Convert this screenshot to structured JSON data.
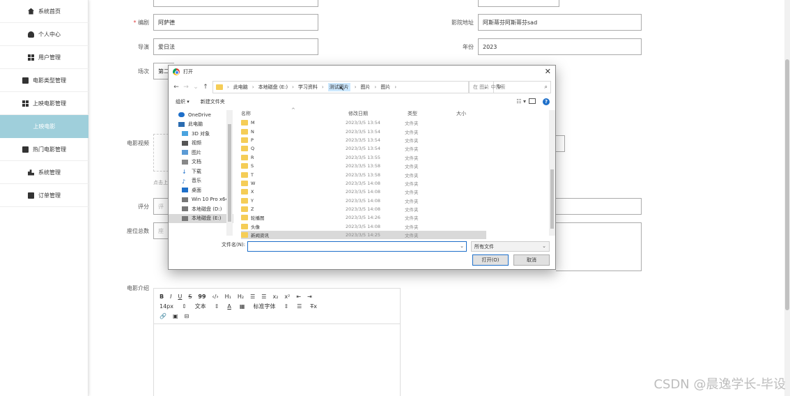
{
  "sidebar": {
    "items": [
      {
        "label": "系统首页",
        "icon": "home-icon"
      },
      {
        "label": "个人中心",
        "icon": "user-icon"
      },
      {
        "label": "用户管理",
        "icon": "grid-icon"
      },
      {
        "label": "电影类型管理",
        "icon": "clipboard-icon"
      },
      {
        "label": "上映电影管理",
        "icon": "grid-icon"
      },
      {
        "label": "上映电影",
        "icon": "none"
      },
      {
        "label": "热门电影管理",
        "icon": "clipboard-icon"
      },
      {
        "label": "系统管理",
        "icon": "chart-icon"
      },
      {
        "label": "订单管理",
        "icon": "clipboard-icon"
      }
    ],
    "active_index": 5
  },
  "form": {
    "bianju_label": "编剧",
    "bianju_required": "*",
    "bianju_value": "阿萨德",
    "daoyan_label": "导演",
    "daoyan_value": "爱日法",
    "changci_label": "场次",
    "changci_value": "第二",
    "video_label": "电影视频",
    "upload_hint": "点击上",
    "pingfen_label": "评分",
    "pingfen_placeholder": "评",
    "seat_label": "座位总数",
    "seat_placeholder": "座",
    "address_label": "影院地址",
    "address_value": "阿斯蒂芬阿斯蒂芬sad",
    "year_label": "年份",
    "year_value": "2023",
    "intro_label": "电影介绍"
  },
  "editor": {
    "row1": [
      "B",
      "I",
      "U",
      "S",
      "99",
      "‹/›",
      "H₁",
      "H₂",
      "☰",
      "☰",
      "x₂",
      "x²",
      "⇤",
      "⇥"
    ],
    "font_size": "14px",
    "text_label": "文本",
    "font_family": "标准字体",
    "clear": "T̶x"
  },
  "dialog": {
    "title": "打开",
    "close": "✕",
    "path": [
      "此电脑",
      "本地磁盘 (E:)",
      "学习资料",
      "测试图片",
      "图片",
      "图片"
    ],
    "search_placeholder": "在 图片 中搜索",
    "organize": "组织 ▾",
    "new_folder": "新建文件夹",
    "columns": {
      "name": "名称",
      "date": "修改日期",
      "type": "类型",
      "size": "大小"
    },
    "nav_items": [
      {
        "label": "OneDrive",
        "icon": "cloud-icon"
      },
      {
        "label": "此电脑",
        "icon": "pc-icon"
      },
      {
        "label": "3D 对象",
        "icon": "cube-icon"
      },
      {
        "label": "视频",
        "icon": "video-icon"
      },
      {
        "label": "图片",
        "icon": "picture-icon"
      },
      {
        "label": "文档",
        "icon": "doc-icon"
      },
      {
        "label": "下载",
        "icon": "download-icon"
      },
      {
        "label": "音乐",
        "icon": "music-icon"
      },
      {
        "label": "桌面",
        "icon": "desktop-icon"
      },
      {
        "label": "Win 10 Pro x64",
        "icon": "drive-icon"
      },
      {
        "label": "本地磁盘 (D:)",
        "icon": "drive-icon"
      },
      {
        "label": "本地磁盘 (E:)",
        "icon": "drive-icon"
      }
    ],
    "nav_selected": 11,
    "files": [
      {
        "name": "M",
        "date": "2023/3/5 13:54",
        "type": "文件夹"
      },
      {
        "name": "N",
        "date": "2023/3/5 13:54",
        "type": "文件夹"
      },
      {
        "name": "P",
        "date": "2023/3/5 13:54",
        "type": "文件夹"
      },
      {
        "name": "Q",
        "date": "2023/3/5 13:54",
        "type": "文件夹"
      },
      {
        "name": "R",
        "date": "2023/3/5 13:55",
        "type": "文件夹"
      },
      {
        "name": "S",
        "date": "2023/3/5 13:58",
        "type": "文件夹"
      },
      {
        "name": "T",
        "date": "2023/3/5 13:58",
        "type": "文件夹"
      },
      {
        "name": "W",
        "date": "2023/3/5 14:08",
        "type": "文件夹"
      },
      {
        "name": "X",
        "date": "2023/3/5 14:08",
        "type": "文件夹"
      },
      {
        "name": "Y",
        "date": "2023/3/5 14:08",
        "type": "文件夹"
      },
      {
        "name": "Z",
        "date": "2023/3/5 14:08",
        "type": "文件夹"
      },
      {
        "name": "轮播图",
        "date": "2023/3/5 14:26",
        "type": "文件夹"
      },
      {
        "name": "头像",
        "date": "2023/3/5 14:08",
        "type": "文件夹"
      },
      {
        "name": "新闻资讯",
        "date": "2023/3/5 14:25",
        "type": "文件夹"
      }
    ],
    "file_selected": 13,
    "filename_label": "文件名(N):",
    "filename_value": "",
    "filter": "所有文件",
    "open_button": "打开(O)",
    "cancel_button": "取消"
  },
  "watermark": "CSDN @晨逸学长-毕设"
}
